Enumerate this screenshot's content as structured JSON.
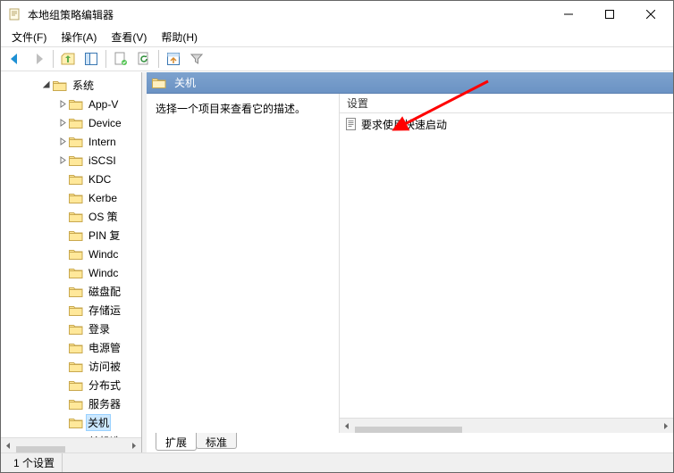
{
  "window": {
    "title": "本地组策略编辑器"
  },
  "menu": {
    "file": "文件(F)",
    "action": "操作(A)",
    "view": "查看(V)",
    "help": "帮助(H)"
  },
  "tree": {
    "root": "系统",
    "items": [
      "App-V",
      "Device",
      "Intern",
      "iSCSI",
      "KDC",
      "Kerbe",
      "OS 策",
      "PIN 复",
      "Windc",
      "Windc",
      "磁盘配",
      "存储运",
      "登录",
      "电源管",
      "访问被",
      "分布式",
      "服务器",
      "关机",
      "关机选"
    ],
    "selected": "关机"
  },
  "right": {
    "header": "关机",
    "desc": "选择一个项目来查看它的描述。",
    "column_header": "设置",
    "items": [
      {
        "label": "要求使用快速启动"
      }
    ]
  },
  "tabs": {
    "extended": "扩展",
    "standard": "标准"
  },
  "status": {
    "text": "1 个设置"
  }
}
